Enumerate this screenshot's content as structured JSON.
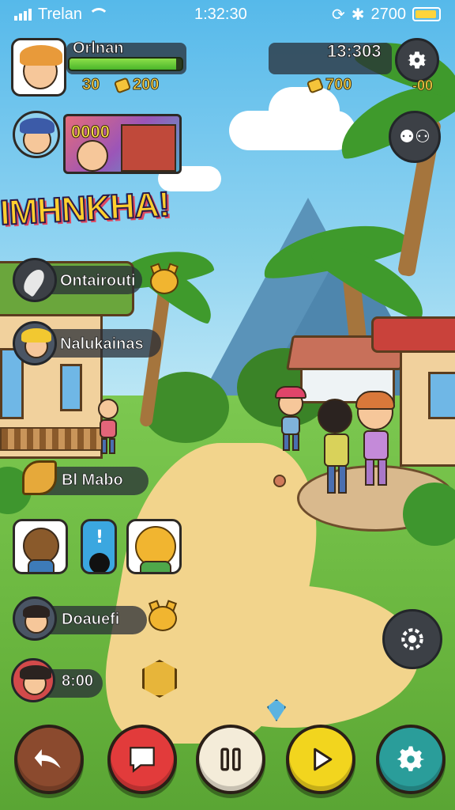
{
  "status_bar": {
    "carrier": "Trelan",
    "time": "1:32:30",
    "battery": "2700"
  },
  "hud": {
    "player_name": "Orlnan",
    "health_fraction": 0.95,
    "stat_left": "30",
    "stat_coins": "200",
    "clock": "13:303",
    "gold": "700",
    "settings_counter": "-00",
    "banner_value": "0000"
  },
  "title": "IMHNKHA!",
  "menu": [
    {
      "label": "Ontairouti"
    },
    {
      "label": "Nalukainas"
    },
    {
      "label": "Bl Mabo"
    },
    {
      "label": "Doauefi"
    },
    {
      "label": "8:00"
    }
  ],
  "bottom_bar": [
    {
      "icon": "back-arrow-icon",
      "color": "#8b4a2e"
    },
    {
      "icon": "chat-icon",
      "color": "#e23b3b"
    },
    {
      "icon": "pause-icon",
      "color": "#f4ecd9"
    },
    {
      "icon": "play-icon",
      "color": "#f2d51e"
    },
    {
      "icon": "gear-icon",
      "color": "#2a9d9a"
    }
  ]
}
